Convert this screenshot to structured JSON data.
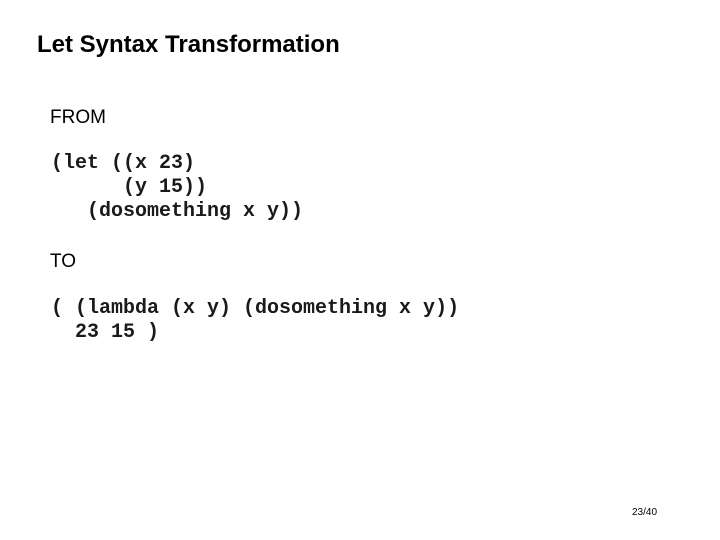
{
  "slide": {
    "title": "Let Syntax Transformation",
    "from_label": "FROM",
    "from_code": [
      "(let ((x 23)",
      "      (y 15))",
      "   (dosomething x y))"
    ],
    "to_label": "TO",
    "to_code": [
      "( (lambda (x y) (dosomething x y))",
      "  23 15 )"
    ],
    "page_number": "23/40"
  }
}
